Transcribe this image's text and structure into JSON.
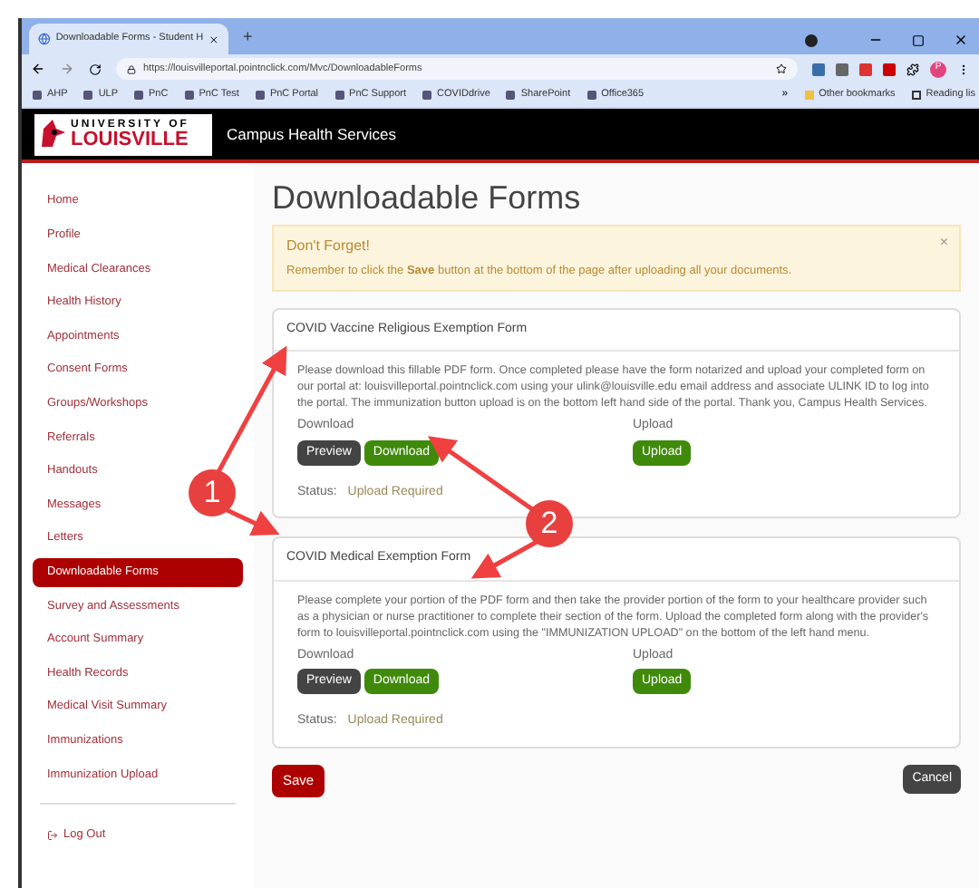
{
  "browser": {
    "tab_title": "Downloadable Forms - Student H",
    "new_tab": "+",
    "url": "https://louisvilleportal.pointnclick.com/Mvc/DownloadableForms",
    "profile": "P",
    "bookmarks": [
      "AHP",
      "ULP",
      "PnC",
      "PnC Test",
      "PnC Portal",
      "PnC Support",
      "COVIDdrive",
      "SharePoint",
      "Office365"
    ],
    "more": "»",
    "other_bookmarks": "Other bookmarks",
    "reading_list": "Reading lis"
  },
  "header": {
    "logo_top": "UNIVERSITY OF",
    "logo_bottom": "LOUISVILLE",
    "site_title": "Campus Health Services"
  },
  "sidebar": {
    "items": [
      {
        "label": "Home",
        "selected": false
      },
      {
        "label": "Profile",
        "selected": false
      },
      {
        "label": "Medical Clearances",
        "selected": false
      },
      {
        "label": "Health History",
        "selected": false
      },
      {
        "label": "Appointments",
        "selected": false
      },
      {
        "label": "Consent Forms",
        "selected": false
      },
      {
        "label": "Groups/Workshops",
        "selected": false
      },
      {
        "label": "Referrals",
        "selected": false
      },
      {
        "label": "Handouts",
        "selected": false
      },
      {
        "label": "Messages",
        "selected": false
      },
      {
        "label": "Letters",
        "selected": false
      },
      {
        "label": "Downloadable Forms",
        "selected": true
      },
      {
        "label": "Survey and Assessments",
        "selected": false
      },
      {
        "label": "Account Summary",
        "selected": false
      },
      {
        "label": "Health Records",
        "selected": false
      },
      {
        "label": "Medical Visit Summary",
        "selected": false
      },
      {
        "label": "Immunizations",
        "selected": false
      },
      {
        "label": "Immunization Upload",
        "selected": false
      }
    ],
    "logout": "Log Out"
  },
  "page_title": "Downloadable Forms",
  "alert": {
    "title": "Don't Forget!",
    "message": "Remember to click the **Save** button at the bottom of the page after uploading all your documents.",
    "close": "×"
  },
  "forms": [
    {
      "title": "COVID Vaccine Religious Exemption Form",
      "description": "Please download this fillable PDF form. Once completed please have the form notarized and upload your completed form on our portal at: louisvilleportal.pointnclick.com using your ulink@louisville.edu email address and associate ULINK ID to log into the portal. The immunization button upload is on the bottom left hand side of the portal. Thank you, Campus Health Services.",
      "download_label": "Download",
      "preview": "Preview",
      "download": "Download",
      "upload_label": "Upload",
      "upload": "Upload",
      "status_label": "Status:",
      "status": "Upload Required"
    },
    {
      "title": "COVID Medical Exemption Form",
      "description": "Please complete your portion of the PDF form and then take the provider portion of the form to your healthcare provider such as a physician or nurse practitioner to complete their section of the form. Upload the completed form along with the provider's form to louisvilleportal.pointnclick.com using the \"IMMUNIZATION UPLOAD\" on the bottom of the left hand menu.",
      "download_label": "Download",
      "preview": "Preview",
      "download": "Download",
      "upload_label": "Upload",
      "upload": "Upload",
      "status_label": "Status:",
      "status": "Upload Required"
    }
  ],
  "buttons": {
    "save": "Save",
    "cancel": "Cancel"
  },
  "annotations": [
    {
      "number": "1"
    },
    {
      "number": "2"
    }
  ]
}
